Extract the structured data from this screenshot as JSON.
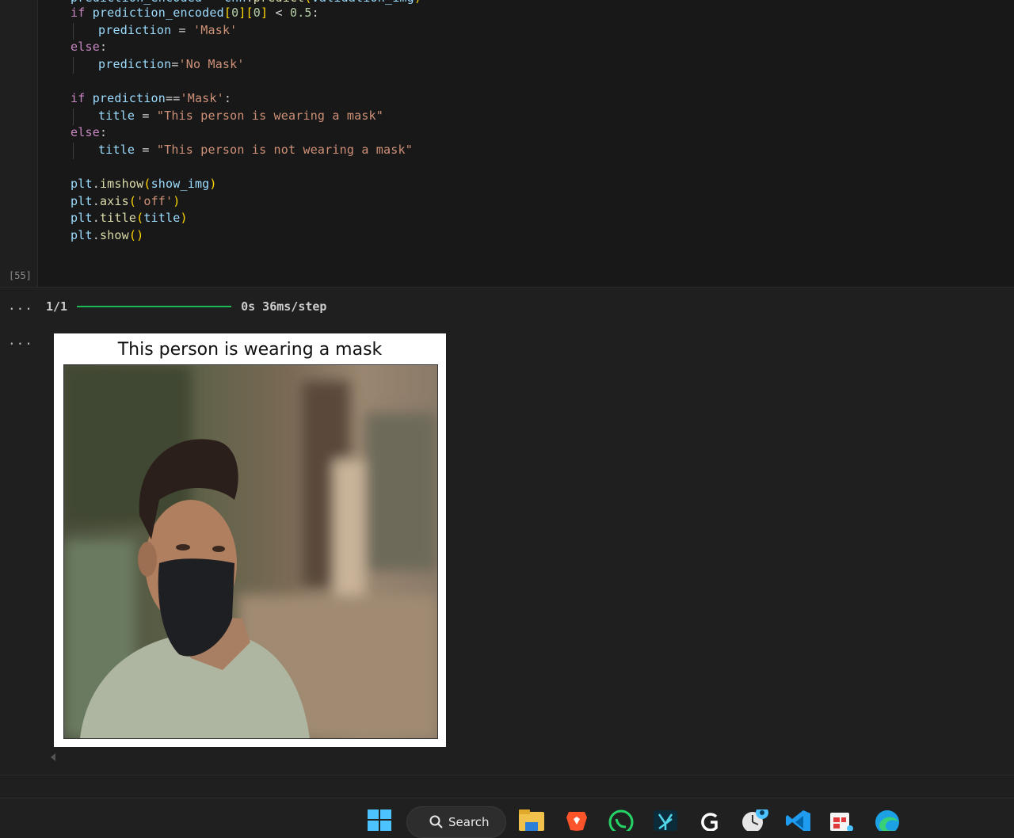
{
  "notebook": {
    "execution_count": "[55]",
    "code_lines": [
      "prediction_encoded = cnn.predict(validation_img)",
      "if prediction_encoded[0][0] < 0.5:",
      "prediction = 'Mask'",
      "else:",
      "prediction='No Mask'",
      "",
      "if prediction=='Mask':",
      "title = \"This person is wearing a mask\"",
      "else:",
      "title = \"This person is not wearing a mask\"",
      "",
      "plt.imshow(show_img)",
      "plt.axis('off')",
      "plt.title(title)",
      "plt.show()"
    ],
    "output_menu": "...",
    "progress": {
      "label": "1/1",
      "fraction": 1.0,
      "time": "0s 36ms/step",
      "bar_color": "#1db954"
    },
    "figure_title": "This person is wearing a mask"
  },
  "taskbar": {
    "search_label": "Search",
    "icons": [
      "windows-start-icon",
      "search-icon",
      "file-explorer-icon",
      "brave-browser-icon",
      "whatsapp-icon",
      "app-icon",
      "logitech-g-icon",
      "clock-app-icon",
      "vscode-icon",
      "snipping-tool-icon",
      "edge-browser-icon"
    ]
  }
}
